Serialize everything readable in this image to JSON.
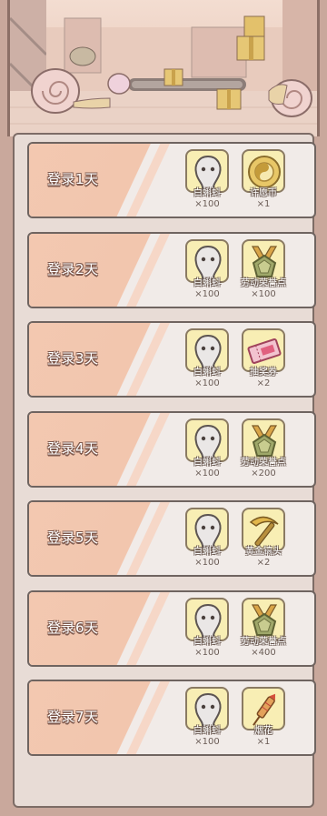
{
  "rows": [
    {
      "day": "登录1天",
      "items": [
        {
          "name": "白蝌蚪",
          "qty": "×100",
          "icon": "white-tadpole-icon"
        },
        {
          "name": "许愿币",
          "qty": "×1",
          "icon": "wish-coin-icon"
        }
      ]
    },
    {
      "day": "登录2天",
      "items": [
        {
          "name": "白蝌蚪",
          "qty": "×100",
          "icon": "white-tadpole-icon"
        },
        {
          "name": "劳动荣誉点",
          "qty": "×100",
          "icon": "labor-honor-medal-icon"
        }
      ]
    },
    {
      "day": "登录3天",
      "items": [
        {
          "name": "白蝌蚪",
          "qty": "×100",
          "icon": "white-tadpole-icon"
        },
        {
          "name": "抽奖券",
          "qty": "×2",
          "icon": "lottery-ticket-icon"
        }
      ]
    },
    {
      "day": "登录4天",
      "items": [
        {
          "name": "白蝌蚪",
          "qty": "×100",
          "icon": "white-tadpole-icon"
        },
        {
          "name": "劳动荣誉点",
          "qty": "×200",
          "icon": "labor-honor-medal-icon"
        }
      ]
    },
    {
      "day": "登录5天",
      "items": [
        {
          "name": "白蝌蚪",
          "qty": "×100",
          "icon": "white-tadpole-icon"
        },
        {
          "name": "黄金镐头",
          "qty": "×2",
          "icon": "golden-pickaxe-icon"
        }
      ]
    },
    {
      "day": "登录6天",
      "items": [
        {
          "name": "白蝌蚪",
          "qty": "×100",
          "icon": "white-tadpole-icon"
        },
        {
          "name": "劳动荣誉点",
          "qty": "×400",
          "icon": "labor-honor-medal-icon"
        }
      ]
    },
    {
      "day": "登录7天",
      "items": [
        {
          "name": "白蝌蚪",
          "qty": "×100",
          "icon": "white-tadpole-icon"
        },
        {
          "name": "烟花",
          "qty": "×1",
          "icon": "firework-rocket-icon"
        }
      ]
    }
  ],
  "colors": {
    "stripe": "#f3c6ad",
    "item_bg": "#f8eeb4",
    "panel": "#e8dcd6"
  }
}
